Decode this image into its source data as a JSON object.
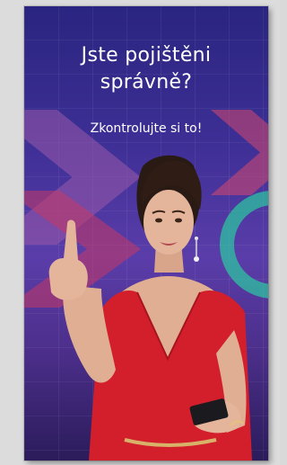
{
  "banner": {
    "headline_line1": "Jste pojištěni",
    "headline_line2": "správně?",
    "subheadline": "Zkontrolujte si to!",
    "colors": {
      "background_top": "#2a2580",
      "background_mid": "#5a3da9",
      "accent_pink": "#d6486d",
      "accent_green": "#28d7a0",
      "dress_red": "#d21f2b"
    },
    "image": "woman-in-red-dress-pointing-up-holding-phone"
  }
}
